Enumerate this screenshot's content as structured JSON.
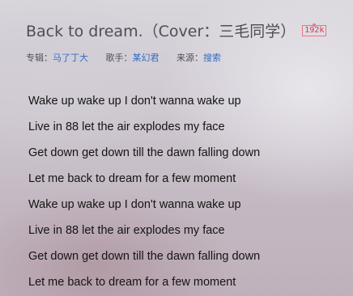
{
  "song": {
    "title": "Back to dream.（Cover：三毛同学）",
    "quality": "192k"
  },
  "meta": {
    "album_label": "专辑：",
    "album": "马了丁大",
    "singer_label": "歌手：",
    "singer": "某幻君",
    "source_label": "来源：",
    "source": "搜索"
  },
  "lyrics": [
    "Wake up wake up I don't wanna wake up",
    "Live in 88 let the air explodes my face",
    "Get down get down till the dawn falling down",
    "Let me back to dream for a few moment",
    "Wake up wake up I don't wanna wake up",
    "Live in 88 let the air explodes my face",
    "Get down get down till the dawn falling down",
    "Let me back to dream for a few moment"
  ]
}
